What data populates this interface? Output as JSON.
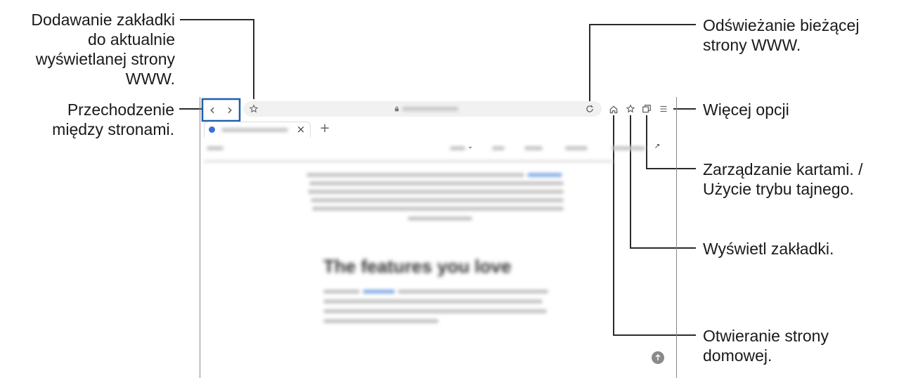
{
  "callouts": {
    "bookmark_add": [
      "Dodawanie zakładki",
      "do aktualnie",
      "wyświetlanej strony",
      "WWW."
    ],
    "navigate": [
      "Przechodzenie",
      "między stronami."
    ],
    "refresh": [
      "Odświeżanie bieżącej",
      "strony WWW."
    ],
    "more_options": [
      "Więcej opcji"
    ],
    "tabs": [
      "Zarządzanie kartami. /",
      "Użycie trybu tajnego."
    ],
    "view_bookmarks": [
      "Wyświetl zakładki."
    ],
    "home": [
      "Otwieranie strony",
      "domowej."
    ]
  },
  "browser": {
    "new_tab_symbol": "+",
    "close_tab_symbol": "×",
    "back_symbol": "‹",
    "forward_symbol": "›",
    "blurred_heading": "The features you love",
    "icons": [
      "chevron-left-icon",
      "chevron-right-icon",
      "star-icon",
      "lock-icon",
      "refresh-icon",
      "home-icon",
      "bookmarks-icon",
      "tabs-icon",
      "menu-icon",
      "scroll-up-icon"
    ]
  },
  "colors": {
    "line": "#2b2b2b",
    "highlight_box": "#1f5fb0",
    "scroll_button": "#8a8a8a"
  }
}
